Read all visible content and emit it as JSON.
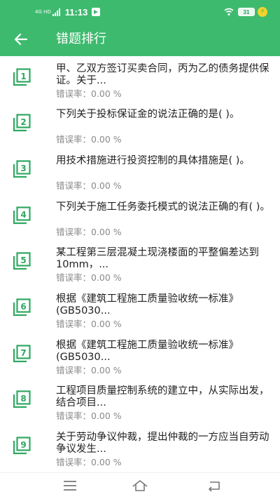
{
  "status_bar": {
    "network": "4G HD",
    "time": "11:13",
    "battery": "31"
  },
  "header": {
    "title": "错题排行"
  },
  "list": {
    "items": [
      {
        "rank": "1",
        "text": "甲、乙双方签订买卖合同，丙为乙的债务提供保证。关于...",
        "rate": "错误率：0.00 %"
      },
      {
        "rank": "2",
        "text": "下列关于投标保证金的说法正确的是( )。",
        "rate": "错误率：0.00 %"
      },
      {
        "rank": "3",
        "text": "用技术措施进行投资控制的具体措施是( )。",
        "rate": "错误率：0.00 %"
      },
      {
        "rank": "4",
        "text": "下列关于施工任务委托模式的说法正确的有( )。",
        "rate": "错误率：0.00 %"
      },
      {
        "rank": "5",
        "text": "某工程第三层混凝土现浇楼面的平整偏差达到10mm，...",
        "rate": "错误率：0.00 %"
      },
      {
        "rank": "6",
        "text": "根据《建筑工程施工质量验收统一标准》(GB5030...",
        "rate": "错误率：0.00 %"
      },
      {
        "rank": "7",
        "text": "根据《建筑工程施工质量验收统一标准》(GB5030...",
        "rate": "错误率：0.00 %"
      },
      {
        "rank": "8",
        "text": "工程项目质量控制系统的建立中，从实际出发，结合项目...",
        "rate": "错误率：0.00 %"
      },
      {
        "rank": "9",
        "text": "关于劳动争议仲裁，提出仲裁的一方应当自劳动争议发生...",
        "rate": "错误率：0.00 %"
      }
    ]
  },
  "icons": {
    "back": "arrow-left-icon",
    "rank": "stacked-number-icon",
    "nav": [
      "menu-icon",
      "home-icon",
      "back-icon"
    ]
  },
  "colors": {
    "primary": "#3dba6e",
    "rank_icon": "#2fa862",
    "rate_text": "#8a8a8a"
  }
}
